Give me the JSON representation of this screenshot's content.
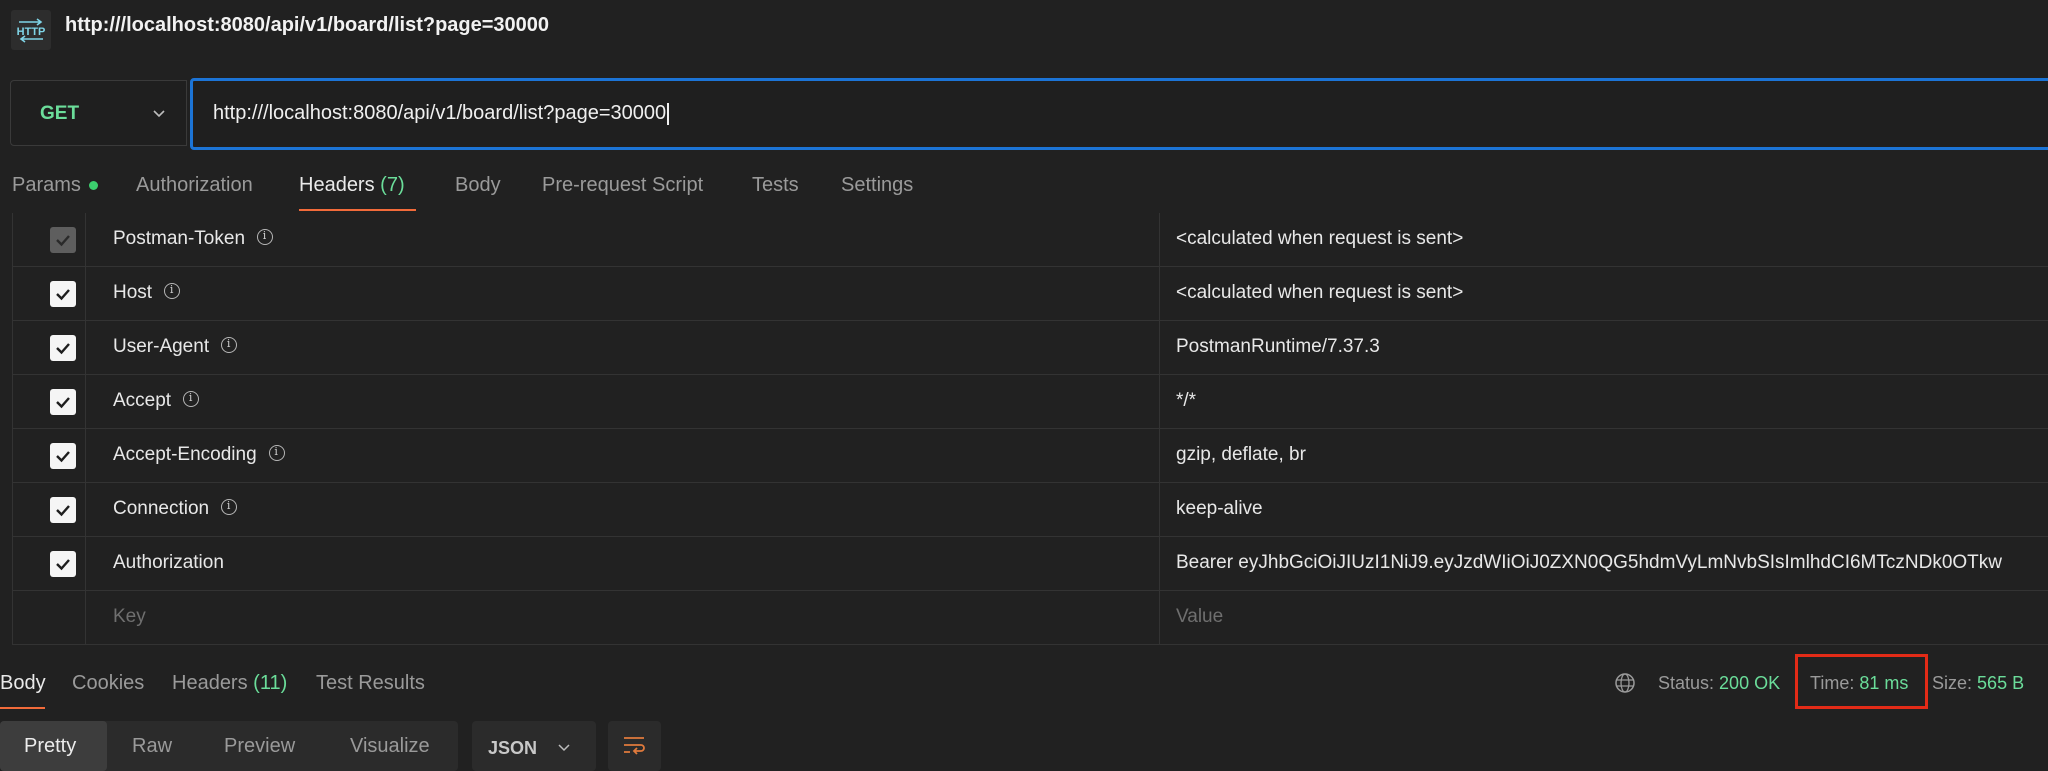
{
  "title": {
    "badge_text": "HTTP",
    "url": "http:///localhost:8080/api/v1/board/list?page=30000"
  },
  "request": {
    "method": "GET",
    "url": "http:///localhost:8080/api/v1/board/list?page=30000"
  },
  "request_tabs": {
    "params": "Params",
    "authorization": "Authorization",
    "headers": "Headers",
    "headers_count": "(7)",
    "body": "Body",
    "pre_request": "Pre-request Script",
    "tests": "Tests",
    "settings": "Settings"
  },
  "headers": [
    {
      "key": "Postman-Token",
      "value": "<calculated when request is sent>",
      "checked": true,
      "locked": true
    },
    {
      "key": "Host",
      "value": "<calculated when request is sent>",
      "checked": true
    },
    {
      "key": "User-Agent",
      "value": "PostmanRuntime/7.37.3",
      "checked": true
    },
    {
      "key": "Accept",
      "value": "*/*",
      "checked": true
    },
    {
      "key": "Accept-Encoding",
      "value": "gzip, deflate, br",
      "checked": true
    },
    {
      "key": "Connection",
      "value": "keep-alive",
      "checked": true
    },
    {
      "key": "Authorization",
      "value": "Bearer eyJhbGciOiJIUzI1NiJ9.eyJzdWIiOiJ0ZXN0QG5hdmVyLmNvbSIsImlhdCI6MTczNDk0OTkw",
      "checked": true
    }
  ],
  "new_header": {
    "key_placeholder": "Key",
    "value_placeholder": "Value"
  },
  "response_tabs": {
    "body": "Body",
    "cookies": "Cookies",
    "headers": "Headers",
    "headers_count": "(11)",
    "test_results": "Test Results"
  },
  "response_meta": {
    "status_label": "Status:",
    "status_value": "200 OK",
    "time_label": "Time:",
    "time_value": "81 ms",
    "size_label": "Size:",
    "size_value": "565 B"
  },
  "view_modes": {
    "pretty": "Pretty",
    "raw": "Raw",
    "preview": "Preview",
    "visualize": "Visualize"
  },
  "format": "JSON",
  "colors": {
    "accent_green": "#6bdd9a",
    "url_border": "#1c74d6",
    "tab_underline": "#f26b3a",
    "highlight_box": "#e32b17"
  }
}
